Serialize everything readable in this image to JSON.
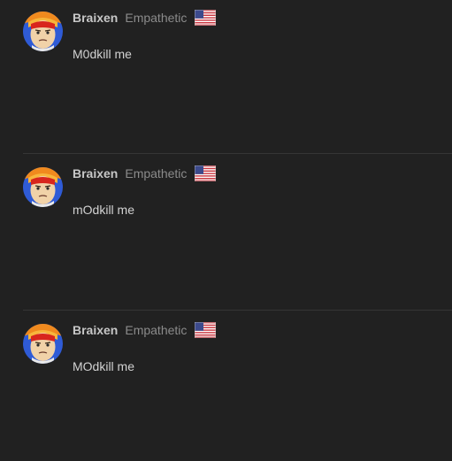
{
  "posts": [
    {
      "author": "Braixen",
      "rank": "Empathetic",
      "flag_icon": "us-flag-icon",
      "text": "M0dkill me"
    },
    {
      "author": "Braixen",
      "rank": "Empathetic",
      "flag_icon": "us-flag-icon",
      "text": "mOdkill me"
    },
    {
      "author": "Braixen",
      "rank": "Empathetic",
      "flag_icon": "us-flag-icon",
      "text": "MOdkill me"
    }
  ],
  "colors": {
    "background": "#212121",
    "username": "#c7c7c7",
    "rank": "#8b8b8b",
    "body": "#d2d2d2",
    "divider": "#353535"
  }
}
